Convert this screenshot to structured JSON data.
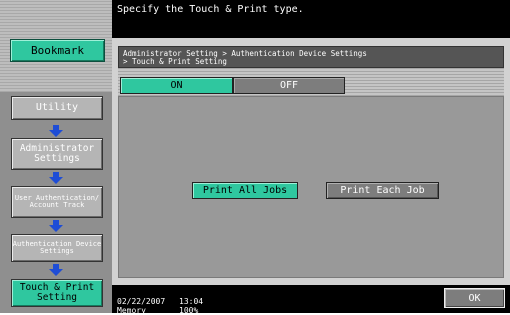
{
  "message": "Specify the Touch & Print type.",
  "sidebar": {
    "bookmark": "Bookmark",
    "utility": "Utility",
    "admin_settings": "Administrator Settings",
    "user_auth": "User Authentication/ Account Track",
    "auth_device": "Authentication Device Settings",
    "touch_print": "Touch & Print Setting"
  },
  "breadcrumb": {
    "line1": "Administrator Setting > Authentication Device Settings",
    "line2": "> Touch & Print Setting"
  },
  "toggle": {
    "on": "ON",
    "off": "OFF",
    "selected": "ON"
  },
  "options": {
    "all": "Print All Jobs",
    "each": "Print Each Job",
    "selected": "Print All Jobs"
  },
  "status": {
    "date": "02/22/2007",
    "time": "13:04",
    "memory_label": "Memory",
    "memory_value": "100%"
  },
  "ok": "OK",
  "colors": {
    "accent": "#2fc79f",
    "panel": "#999999",
    "bar": "#000000"
  }
}
